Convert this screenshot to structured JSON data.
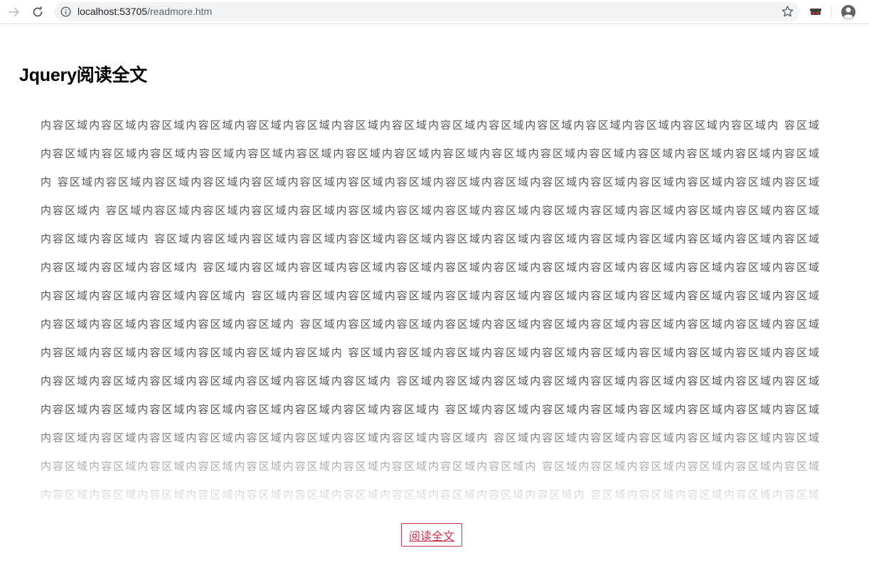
{
  "browser": {
    "url_host": "localhost:53705",
    "url_path": "/readmore.htm"
  },
  "page": {
    "title": "Jquery阅读全文",
    "read_more_label": "阅读全文",
    "button_color": "#c9354c"
  },
  "content": {
    "lines": [
      "内容区域内容区域内容区域内容区域内容区域内容区域内容区域内容区域内容区域内容区域内容区域内容区域内容区域内容区域内容区域内 容区域",
      "内容区域内容区域内容区域内容区域内容区域内容区域内容区域内容区域内容区域内容区域内容区域内容区域内容区域内容区域内容区域内容区域",
      "内 容区域内容区域内容区域内容区域内容区域内容区域内容区域内容区域内容区域内容区域内容区域内容区域内容区域内容区域内容区域内容区域",
      "内容区域内 容区域内容区域内容区域内容区域内容区域内容区域内容区域内容区域内容区域内容区域内容区域内容区域内容区域内容区域内容区域",
      "内容区域内容区域内 容区域内容区域内容区域内容区域内容区域内容区域内容区域内容区域内容区域内容区域内容区域内容区域内容区域内容区域",
      "内容区域内容区域内容区域内 容区域内容区域内容区域内容区域内容区域内容区域内容区域内容区域内容区域内容区域内容区域内容区域内容区域",
      "内容区域内容区域内容区域内容区域内 容区域内容区域内容区域内容区域内容区域内容区域内容区域内容区域内容区域内容区域内容区域内容区域",
      "内容区域内容区域内容区域内容区域内容区域内 容区域内容区域内容区域内容区域内容区域内容区域内容区域内容区域内容区域内容区域内容区域",
      "内容区域内容区域内容区域内容区域内容区域内容区域内 容区域内容区域内容区域内容区域内容区域内容区域内容区域内容区域内容区域内容区域",
      "内容区域内容区域内容区域内容区域内容区域内容区域内容区域内 容区域内容区域内容区域内容区域内容区域内容区域内容区域内容区域内容区域",
      "内容区域内容区域内容区域内容区域内容区域内容区域内容区域内容区域内 容区域内容区域内容区域内容区域内容区域内容区域内容区域内容区域",
      "内容区域内容区域内容区域内容区域内容区域内容区域内容区域内容区域内容区域内 容区域内容区域内容区域内容区域内容区域内容区域内容区域",
      "内容区域内容区域内容区域内容区域内容区域内容区域内容区域内容区域内容区域内容区域内 容区域内容区域内容区域内容区域内容区域内容区域",
      "内容区域内容区域内容区域内容区域内容区域内容区域内容区域内容区域内容区域内容区域内容区域内 容区域内容区域内容区域内容区域内容区域"
    ]
  }
}
